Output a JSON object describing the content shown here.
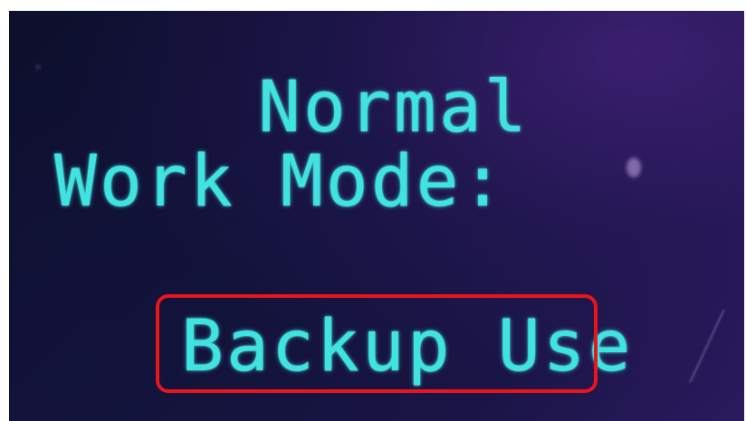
{
  "display": {
    "mode_value": "Normal",
    "mode_label": "Work Mode:",
    "option_highlighted": "Backup Use"
  },
  "colors": {
    "lcd_text": "#3fe3e0",
    "screen_background": "#11123a",
    "highlight_border": "#e8151b"
  }
}
